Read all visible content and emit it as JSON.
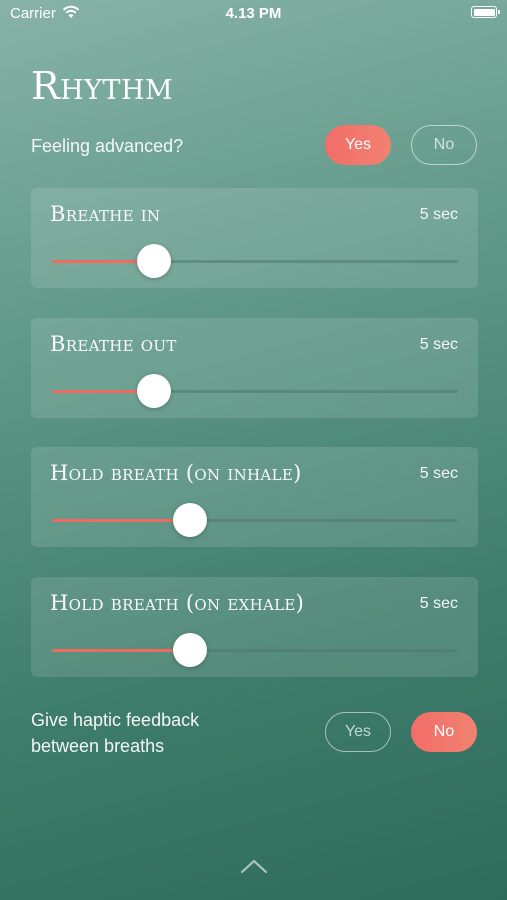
{
  "status_bar": {
    "carrier": "Carrier",
    "time": "4.13 PM"
  },
  "title": "Rhythm",
  "advanced": {
    "label": "Feeling advanced?",
    "yes": "Yes",
    "no": "No",
    "selected": "Yes"
  },
  "sliders": [
    {
      "label": "Breathe in",
      "value": "5 sec",
      "level": 0.25
    },
    {
      "label": "Breathe out",
      "value": "5 sec",
      "level": 0.25
    },
    {
      "label": "Hold breath (on inhale)",
      "value": "5 sec",
      "level": 0.34
    },
    {
      "label": "Hold breath (on exhale)",
      "value": "5 sec",
      "level": 0.34
    }
  ],
  "haptic": {
    "label_line1": "Give haptic feedback",
    "label_line2": "between breaths",
    "yes": "Yes",
    "no": "No",
    "selected": "No"
  },
  "icons": {
    "wifi": "wifi-icon",
    "battery": "battery-icon",
    "chevron": "chevron-up-icon"
  },
  "colors": {
    "accent": "#f36d68",
    "background_top": "#87b3a6",
    "background_bottom": "#2e6b5b"
  }
}
